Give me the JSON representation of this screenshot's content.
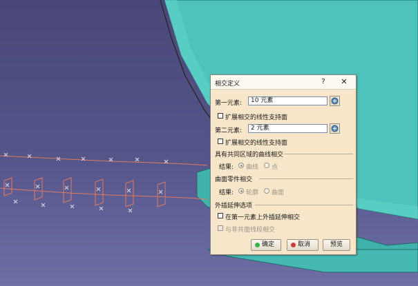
{
  "dialog": {
    "title": "相交定义",
    "help": "?",
    "close": "✕",
    "first_element_label": "第一元素:",
    "first_element_value": "10 元素",
    "extend_lines_1": "扩展相交的线性支持面",
    "second_element_label": "第二元素:",
    "second_element_value": "2 元素",
    "extend_lines_2": "扩展相交的线性支持面",
    "curves_group": {
      "header": "具有共同区域的曲线相交",
      "result_label": "结果:",
      "option_curve": "曲线",
      "option_point": "点"
    },
    "surface_group": {
      "header": "曲面零件相交",
      "result_label": "结果:",
      "option_contour": "轮廓",
      "option_surface": "曲面"
    },
    "extrapolation_group": {
      "header": "外插延伸选项",
      "extrapolate_first": "在第一元素上外插延伸相交",
      "non_coplanar": "与非共面线段相交"
    },
    "buttons": {
      "ok": "确定",
      "cancel": "取消",
      "preview": "预览"
    }
  },
  "colors": {
    "dialog_bg": "#f7e6c9",
    "surface": "#4ec3bb",
    "background": "#4a4878",
    "curve": "#e07a5f",
    "ok_dot": "#3bb54a",
    "cancel_dot": "#d23a3a"
  }
}
